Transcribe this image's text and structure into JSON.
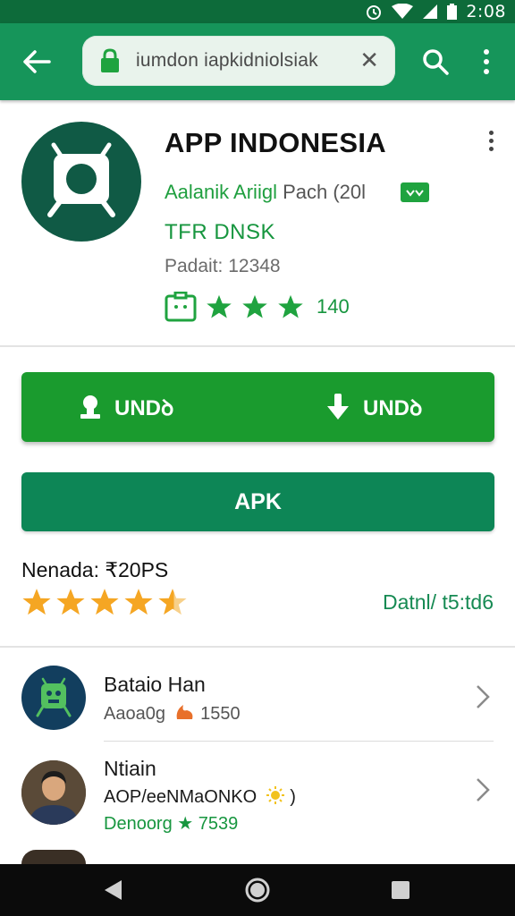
{
  "status_bar": {
    "time": "2:08"
  },
  "toolbar": {
    "url": "iumdon iapkidniolsiak",
    "clear_glyph": "✕"
  },
  "app": {
    "title": "APP INDONESIA",
    "developer_green": "Aalanik Ariigl",
    "developer_gray": " Pach (20l",
    "category": "TFR DNSK",
    "downloads": "Padait: 12348",
    "rating_count": "140"
  },
  "buttons": {
    "left_label": "UNDꝺ",
    "right_label": "UNDꝺ",
    "apk_label": "APK"
  },
  "rating_summary": {
    "label": "Nenada: ₹20PS",
    "details_link": "Datnl/ t5:td6",
    "stars": 4.5
  },
  "list": {
    "items": [
      {
        "title": "Bataio Han",
        "sub": "Aaoa0g",
        "meta": "1550"
      },
      {
        "title": "Ntiain",
        "sub": "AOP/eeNMaONKO",
        "meta": "Denoorg ★ 7539"
      }
    ]
  },
  "colors": {
    "status_bar": "#0d6b3a",
    "toolbar": "#16955a",
    "install_button": "#1a9b2e",
    "apk_button": "#0d8656",
    "accent_green": "#17963f",
    "star_gold": "#f5a623"
  }
}
